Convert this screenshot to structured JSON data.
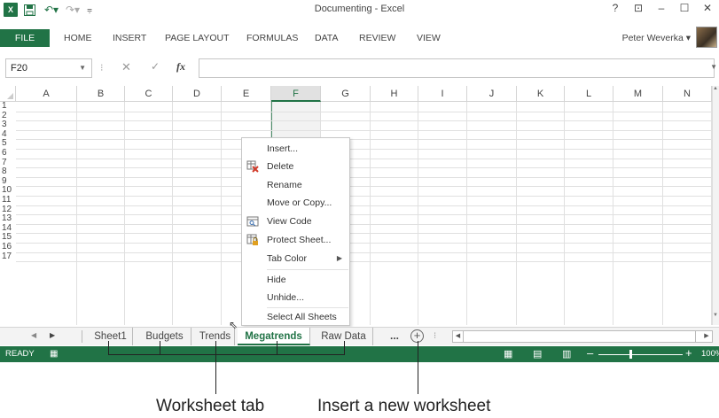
{
  "title_bar": {
    "app_logo": "X",
    "document_title": "Documenting - Excel",
    "window_controls": [
      "?",
      "⊡",
      "–",
      "☐",
      "✕"
    ]
  },
  "ribbon": {
    "tabs": [
      "FILE",
      "HOME",
      "INSERT",
      "PAGE LAYOUT",
      "FORMULAS",
      "DATA",
      "REVIEW",
      "VIEW"
    ],
    "user_name": "Peter Weverka ▾"
  },
  "formula_bar": {
    "name_box": "F20",
    "fx_label": "fx",
    "value": ""
  },
  "grid": {
    "columns": [
      "A",
      "B",
      "C",
      "D",
      "E",
      "F",
      "G",
      "H",
      "I",
      "J",
      "K",
      "L",
      "M",
      "N"
    ],
    "active_column": "F",
    "rows": [
      "1",
      "2",
      "3",
      "4",
      "5",
      "6",
      "7",
      "8",
      "9",
      "10",
      "11",
      "12",
      "13",
      "14",
      "15",
      "16",
      "17"
    ]
  },
  "context_menu": {
    "items": [
      {
        "label": "Insert...",
        "icon": ""
      },
      {
        "label": "Delete",
        "icon": "delete-sheet-icon"
      },
      {
        "label": "Rename",
        "icon": ""
      },
      {
        "label": "Move or Copy...",
        "icon": ""
      },
      {
        "label": "View Code",
        "icon": "view-code-icon"
      },
      {
        "label": "Protect Sheet...",
        "icon": "protect-sheet-icon"
      },
      {
        "label": "Tab Color",
        "icon": "",
        "submenu": true
      },
      {
        "label": "Hide",
        "icon": ""
      },
      {
        "label": "Unhide...",
        "icon": ""
      },
      {
        "label": "Select All Sheets",
        "icon": ""
      }
    ]
  },
  "sheet_tabs": {
    "tabs": [
      "Sheet1",
      "Budgets",
      "Trends",
      "Megatrends",
      "Raw Data"
    ],
    "active": "Megatrends",
    "more": "...",
    "add": "+"
  },
  "status_bar": {
    "status": "READY",
    "zoom": "100%"
  },
  "callouts": {
    "worksheet_tab": "Worksheet tab",
    "insert_worksheet": "Insert a new worksheet"
  },
  "colors": {
    "excel_green": "#217346",
    "grid_line": "#e0e0e0"
  }
}
